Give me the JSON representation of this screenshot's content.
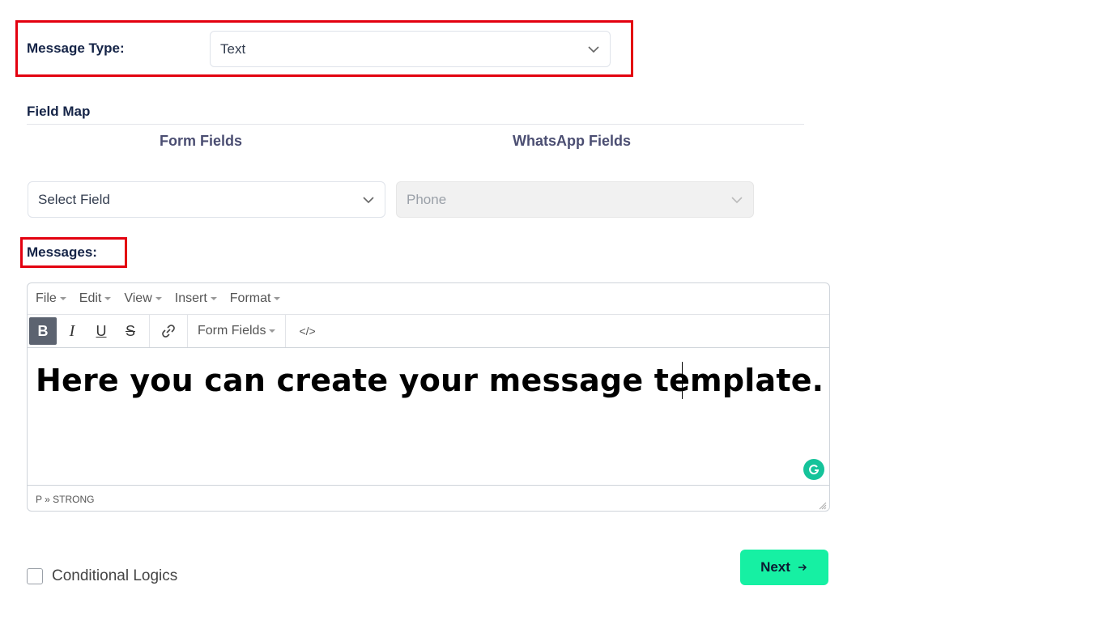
{
  "message_type": {
    "label": "Message Type:",
    "selected": "Text"
  },
  "field_map": {
    "title": "Field Map",
    "form_fields_header": "Form Fields",
    "whatsapp_fields_header": "WhatsApp Fields",
    "form_field_select": "Select Field",
    "whatsapp_field_select": "Phone"
  },
  "messages": {
    "label": "Messages:"
  },
  "editor": {
    "menu": [
      "File",
      "Edit",
      "View",
      "Insert",
      "Format"
    ],
    "toolbar": {
      "bold": "B",
      "italic": "I",
      "underline": "U",
      "strike": "S",
      "form_fields_dropdown": "Form Fields",
      "source_code": "</>"
    },
    "content": "Here you can create your message template.",
    "status_path": "P » STRONG"
  },
  "conditional_logics": {
    "label": "Conditional Logics",
    "checked": false
  },
  "next_button": {
    "label": "Next"
  },
  "colors": {
    "highlight": "#e3000f",
    "next_button": "#16f0a3",
    "grammarly": "#15c39a"
  }
}
